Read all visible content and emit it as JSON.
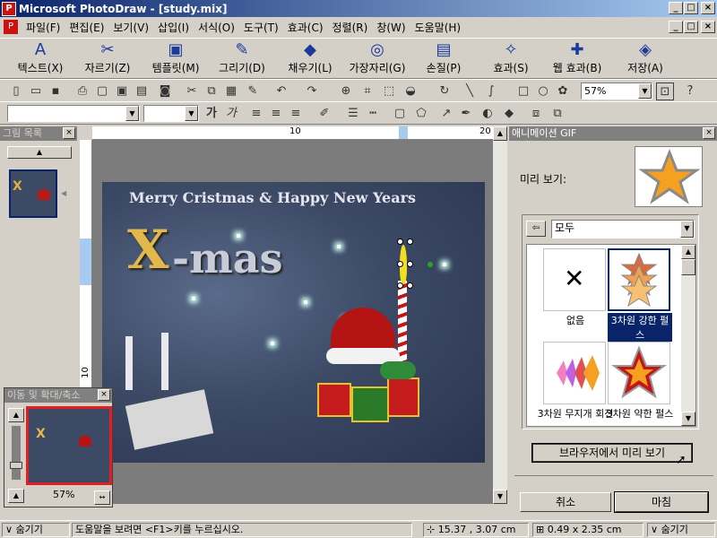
{
  "window": {
    "title": "Microsoft PhotoDraw - [study.mix]"
  },
  "menu": [
    "파일(F)",
    "편집(E)",
    "보기(V)",
    "삽입(I)",
    "서식(O)",
    "도구(T)",
    "효과(C)",
    "정렬(R)",
    "창(W)",
    "도움말(H)"
  ],
  "workspace_toolbar": {
    "text": "텍스트(X)",
    "cutout": "자르기(Z)",
    "templates": "템플릿(M)",
    "draw": "그리기(D)",
    "fill": "채우기(L)",
    "edge": "가장자리(G)",
    "touchup": "손질(P)",
    "effects": "효과(S)",
    "web_effects": "웹 효과(B)",
    "save": "저장(A)"
  },
  "std_toolbar": {
    "zoom_value": "57%"
  },
  "format_toolbar": {
    "font_value": "",
    "size_value": "",
    "bold_glyph": "가",
    "italic_glyph": "가"
  },
  "picture_list": {
    "title": "그림 목록"
  },
  "ruler": {
    "h_label_10": "10",
    "h_label_20": "20",
    "v_label_10": "10"
  },
  "artwork": {
    "greeting": "Merry Cristmas & Happy New Years",
    "big_title_x": "X",
    "big_title_rest": "-mas"
  },
  "pan_zoom": {
    "title": "이동 및 확대/축소",
    "zoom": "57%"
  },
  "anim_panel": {
    "title": "애니메이션 GIF",
    "preview_label": "미리 보기:",
    "category_value": "모두",
    "gallery": [
      {
        "label": "없음"
      },
      {
        "label": "3차원 강한 펄스"
      },
      {
        "label": "3차원 무지개 회전"
      },
      {
        "label": "3차원 약한 펄스"
      }
    ],
    "browser_preview": "브라우저에서 미리 보기",
    "cancel": "취소",
    "finish": "마침"
  },
  "status": {
    "hide_left": "숨기기",
    "help_text": "도움말을 보려면 <F1>키를 누르십시오.",
    "position": "15.37 , 3.07  cm",
    "size": "0.49 x 2.35  cm",
    "hide_right": "숨기기"
  },
  "colors": {
    "titlebar_start": "#0a246a",
    "titlebar_end": "#a6caf0",
    "selected": "#0a246a",
    "star_orange": "#f5a020"
  }
}
